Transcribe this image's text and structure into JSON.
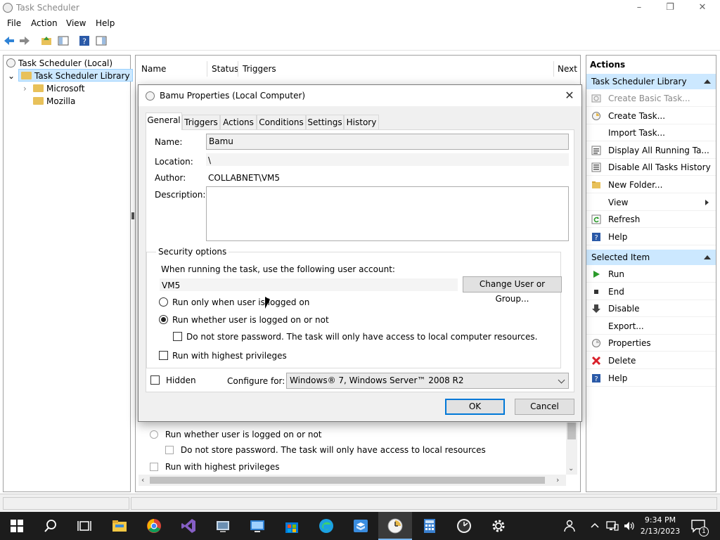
{
  "window": {
    "title": "Task Scheduler",
    "menu": [
      "File",
      "Action",
      "View",
      "Help"
    ]
  },
  "tree": {
    "root": "Task Scheduler (Local)",
    "library": "Task Scheduler Library",
    "children": [
      "Microsoft",
      "Mozilla"
    ]
  },
  "middle": {
    "columns": [
      "Name",
      "Status",
      "Triggers",
      "Next"
    ],
    "background_rows": {
      "run_whether": "Run whether user is logged on or not",
      "no_store": "Do not store password.  The task will only have access to local resources",
      "highest": "Run with highest privileges"
    }
  },
  "actions": {
    "header": "Actions",
    "group1": "Task Scheduler Library",
    "group1_items": [
      {
        "label": "Create Basic Task...",
        "icon": "create-basic-task-icon",
        "disabled": true
      },
      {
        "label": "Create Task...",
        "icon": "create-task-icon"
      },
      {
        "label": "Import Task...",
        "icon": ""
      },
      {
        "label": "Display All Running Ta...",
        "icon": "running-tasks-icon"
      },
      {
        "label": "Disable All Tasks History",
        "icon": "history-icon"
      },
      {
        "label": "New Folder...",
        "icon": "folder-icon"
      },
      {
        "label": "View",
        "icon": "",
        "submenu": true
      },
      {
        "label": "Refresh",
        "icon": "refresh-icon"
      },
      {
        "label": "Help",
        "icon": "help-icon"
      }
    ],
    "group2": "Selected Item",
    "group2_items": [
      {
        "label": "Run",
        "icon": "run-icon"
      },
      {
        "label": "End",
        "icon": "end-icon"
      },
      {
        "label": "Disable",
        "icon": "disable-icon"
      },
      {
        "label": "Export...",
        "icon": ""
      },
      {
        "label": "Properties",
        "icon": "properties-icon"
      },
      {
        "label": "Delete",
        "icon": "delete-icon"
      },
      {
        "label": "Help",
        "icon": "help-icon"
      }
    ]
  },
  "dialog": {
    "title": "Bamu Properties (Local Computer)",
    "tabs": [
      "General",
      "Triggers",
      "Actions",
      "Conditions",
      "Settings",
      "History"
    ],
    "name_label": "Name:",
    "name_value": "Bamu",
    "location_label": "Location:",
    "location_value": "\\",
    "author_label": "Author:",
    "author_value": "COLLABNET\\VM5",
    "description_label": "Description:",
    "description_value": "",
    "security": {
      "title": "Security options",
      "account_prompt": "When running the task, use the following user account:",
      "account": "VM5",
      "change_button": "Change User or Group...",
      "run_only_logged": "Run only when user is logged on",
      "run_whether": "Run whether user is logged on or not",
      "no_store_password": "Do not store password.  The task will only have access to local computer resources.",
      "highest_privileges": "Run with highest privileges"
    },
    "hidden_label": "Hidden",
    "configure_label": "Configure for:",
    "configure_value": "Windows® 7, Windows Server™ 2008 R2",
    "ok": "OK",
    "cancel": "Cancel"
  },
  "taskbar": {
    "time": "9:34 PM",
    "date": "2/13/2023",
    "notification_count": "1"
  },
  "colors": {
    "selection": "#cce8ff",
    "accent": "#0078d7",
    "taskbar": "#1c1c1c"
  }
}
